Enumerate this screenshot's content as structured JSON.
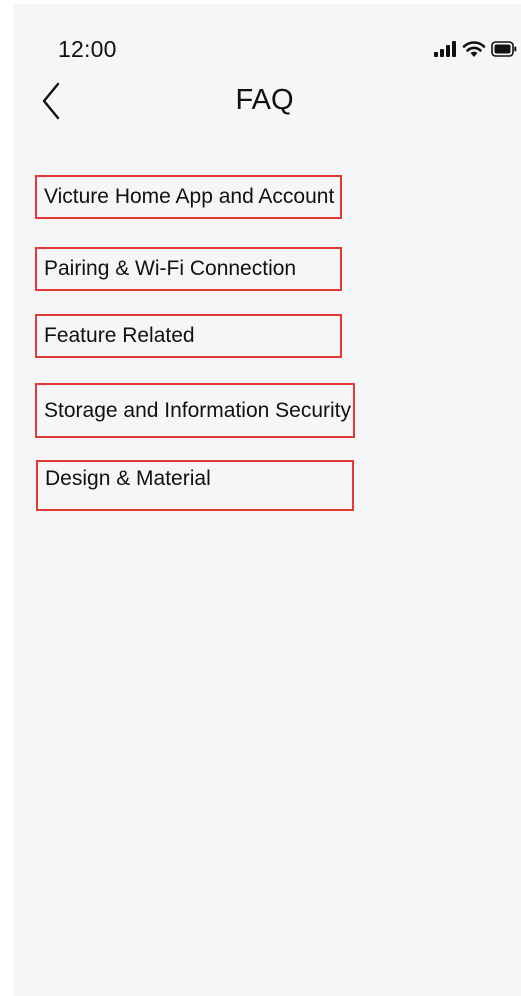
{
  "status_bar": {
    "time": "12:00",
    "signal_icon": "cellular-signal-icon",
    "wifi_icon": "wifi-icon",
    "battery_icon": "battery-icon"
  },
  "nav": {
    "back_icon": "chevron-left-icon",
    "title": "FAQ"
  },
  "faq_categories": [
    {
      "label": "Victure Home App and Account"
    },
    {
      "label": "Pairing & Wi-Fi Connection"
    },
    {
      "label": "Feature Related"
    },
    {
      "label": "Storage and Information Security"
    },
    {
      "label": "Design & Material"
    }
  ],
  "colors": {
    "background": "#f5f6f8",
    "highlight_border": "#e53935",
    "text": "#111111"
  }
}
